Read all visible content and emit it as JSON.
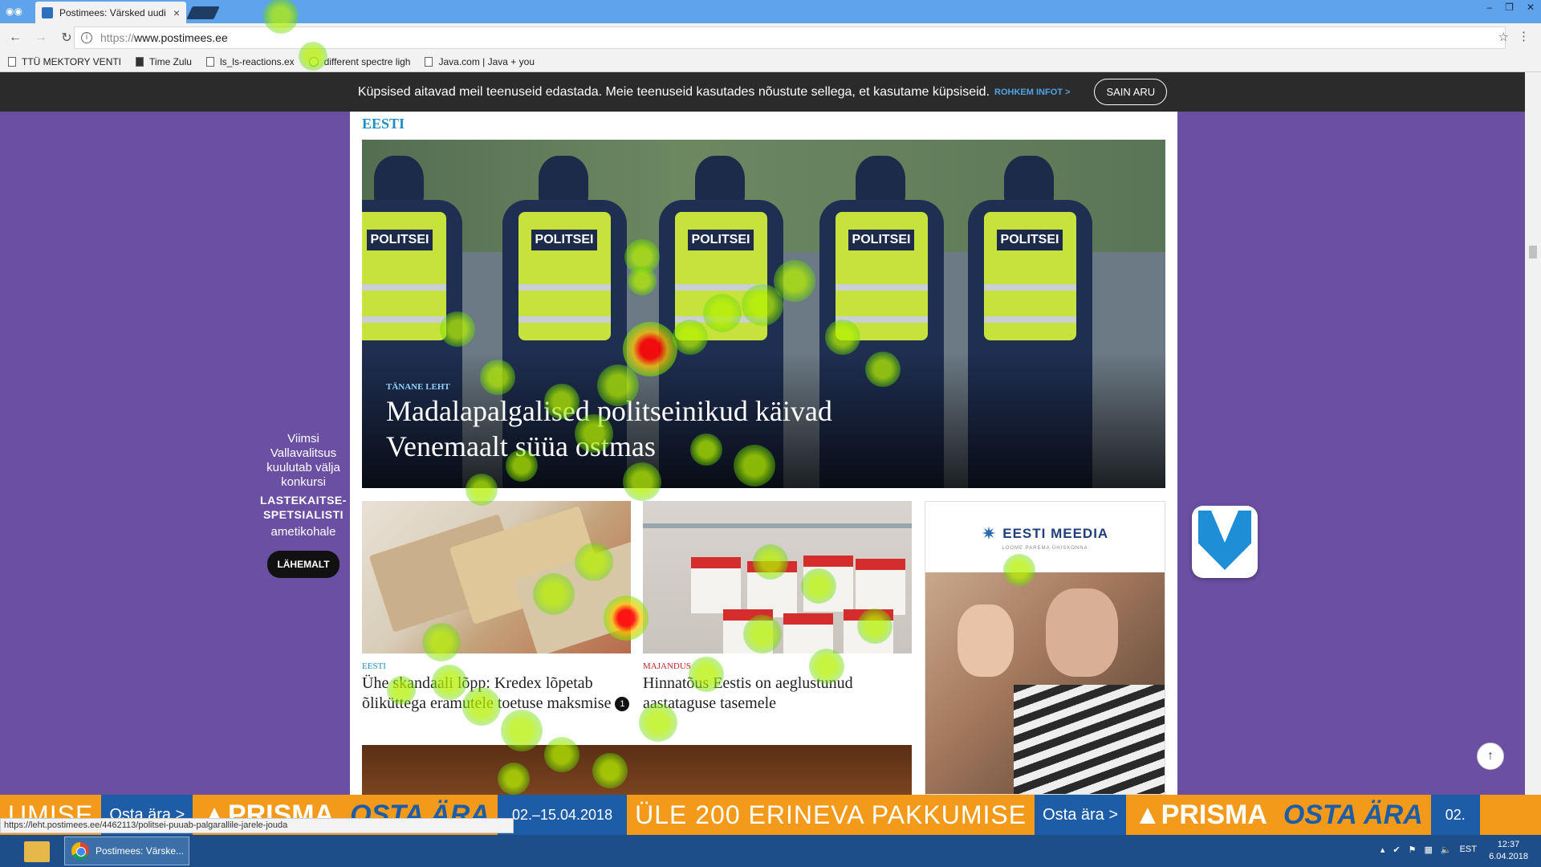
{
  "browser": {
    "tab_title": "Postimees: Värsked uudi",
    "tab_close": "×",
    "url_scheme": "https://",
    "url_host": "www.postimees.ee",
    "star": "☆",
    "menu": "⋮",
    "bookmarks": [
      {
        "label": "TTÜ MEKTORY VENTI"
      },
      {
        "label": "Time Zulu"
      },
      {
        "label": "ls_ls-reactions.ex"
      },
      {
        "label": "different spectre ligh"
      },
      {
        "label": "Java.com | Java + you"
      }
    ],
    "win_controls": [
      "–",
      "❐",
      "✕"
    ]
  },
  "cookie": {
    "text": "Küpsised aitavad meil teenuseid edastada. Meie teenuseid kasutades nõustute sellega, et kasutame küpsiseid.",
    "more": "ROHKEM INFOT >",
    "button": "SAIN ARU"
  },
  "page": {
    "section_title": "EESTI",
    "hero": {
      "kicker": "TÄNANE LEHT",
      "headline": "Madalapalgalised politseinikud käivad Venemaalt süüa ostmas",
      "vest_label": "POLITSEI"
    },
    "cards": [
      {
        "category": "EESTI",
        "category_color": "#1e8fc6",
        "title": "Ühe skandaali lõpp: Kredex lõpetab õliküttega eramutele toetuse maksmise",
        "comments": "1"
      },
      {
        "category": "MAJANDUS",
        "category_color": "#c0272d",
        "title": "Hinnatõus Eestis on aeglustunud aastataguse tasemele"
      }
    ],
    "ad": {
      "brand": "EESTI MEEDIA",
      "slogan": "LOOME PAREMA ÜHISKONNA"
    }
  },
  "side_ad": {
    "line1": "Viimsi Vallavalitsus kuulutab välja konkursi",
    "strong": "LASTEKAITSE-SPETSIALISTI",
    "line2": "ametikohale",
    "button": "LÄHEMALT"
  },
  "banner": {
    "segments": [
      "UMISE",
      "Osta ära >",
      "PRISMA",
      "OSTA ÄRA",
      "02.–15.04.2018",
      "ÜLE 200 ERINEVA PAKKUMISE",
      "Osta ära >",
      "PRISMA",
      "OSTA ÄRA",
      "02."
    ]
  },
  "status_url": "https://leht.postimees.ee/4462113/politsei-puuab-palgarallile-jarele-jouda",
  "taskbar": {
    "task_label": "Postimees: Värske...",
    "language": "EST",
    "time": "12:37",
    "date": "6.04.2018"
  },
  "to_top": "↑"
}
